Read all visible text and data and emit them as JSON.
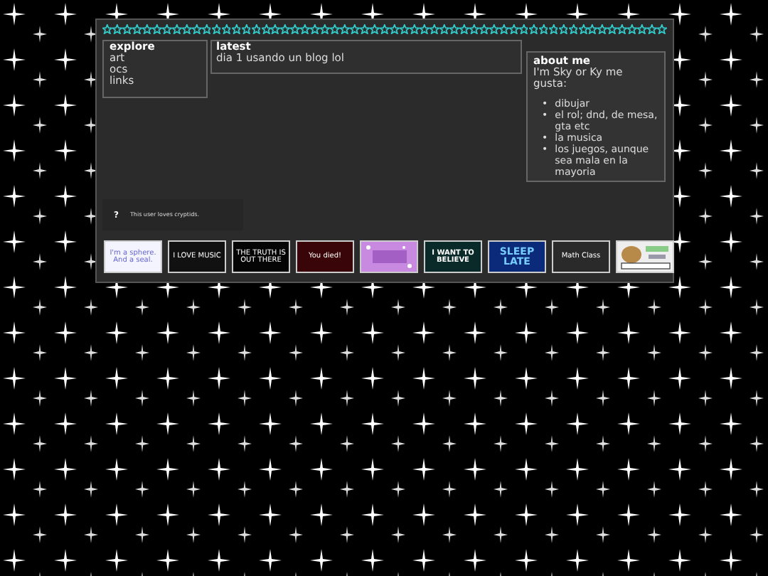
{
  "nav": {
    "title": "explore",
    "links": [
      "art",
      "ocs",
      "links"
    ]
  },
  "latest": {
    "title": "latest",
    "text": "dia 1 usando un blog lol"
  },
  "about": {
    "title": "about me",
    "intro": "I'm Sky or Ky me gusta:",
    "items": [
      {
        "marker": "•",
        "text": "dibujar"
      },
      {
        "marker": "•",
        "text": "el rol; dnd, de mesa, gta etc"
      },
      {
        "marker": "•",
        "text": "la musica"
      },
      {
        "marker": "•",
        "text": "los juegos, aunque sea mala en la mayoria"
      }
    ]
  },
  "userbox": {
    "symbol": "?",
    "text": "This user loves cryptids."
  },
  "stamps": [
    {
      "kind": "sphere",
      "text": "I'm a sphere. And a seal."
    },
    {
      "kind": "music",
      "text": "I LOVE MUSIC"
    },
    {
      "kind": "truth",
      "text": "THE TRUTH IS OUT THERE"
    },
    {
      "kind": "died",
      "text": "You died!"
    },
    {
      "kind": "pink"
    },
    {
      "kind": "believe",
      "text": "I WANT TO BELIEVE"
    },
    {
      "kind": "sleep",
      "text": "SLEEP LATE"
    },
    {
      "kind": "math",
      "text": "Math Class"
    },
    {
      "kind": "picture"
    }
  ]
}
